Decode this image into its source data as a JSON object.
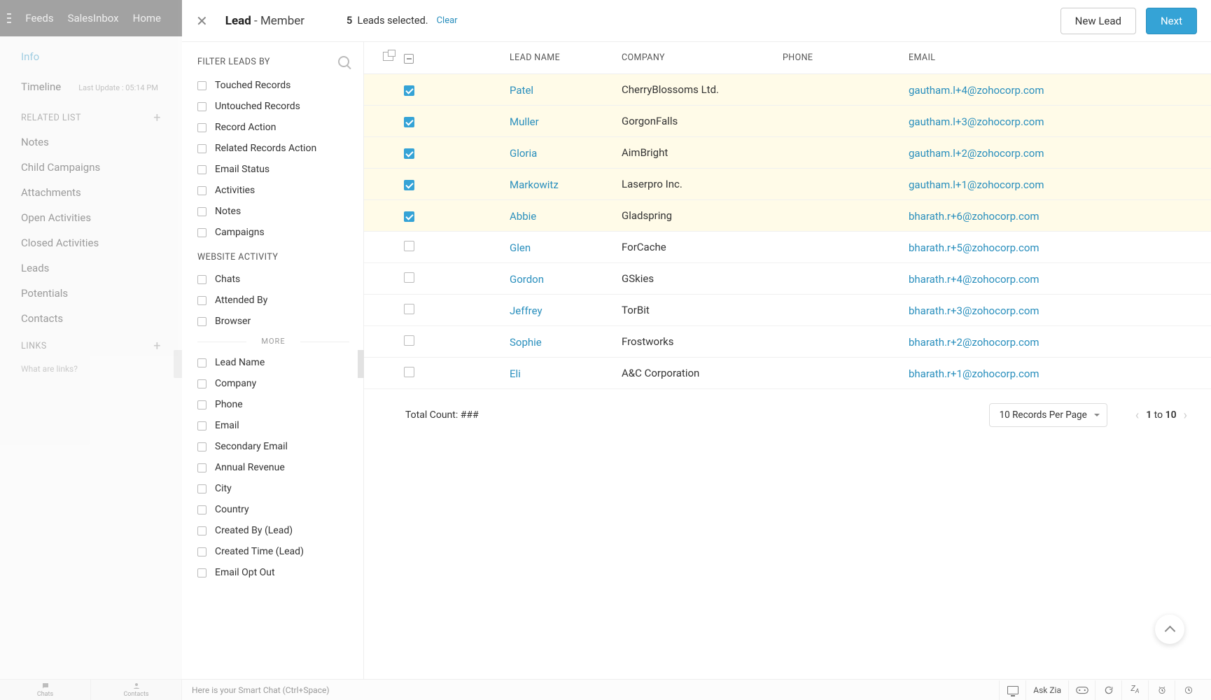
{
  "topnav": {
    "items": [
      "Feeds",
      "SalesInbox",
      "Home"
    ]
  },
  "leftrail": {
    "info": "Info",
    "timeline": "Timeline",
    "last_update": "Last Update : 05:14 PM",
    "related_list": "RELATED LIST",
    "items": [
      "Notes",
      "Child Campaigns",
      "Attachments",
      "Open Activities",
      "Closed Activities",
      "Leads",
      "Potentials",
      "Contacts"
    ],
    "links": "LINKS",
    "what_links": "What are links?"
  },
  "header": {
    "lead_label": "Lead",
    "member_label": " - Member",
    "selected_count": "5",
    "selected_text": "Leads selected.",
    "clear": "Clear",
    "new_lead": "New Lead",
    "next": "Next"
  },
  "filters": {
    "title": "FILTER LEADS BY",
    "group1": [
      "Touched Records",
      "Untouched Records",
      "Record Action",
      "Related Records Action",
      "Email Status",
      "Activities",
      "Notes",
      "Campaigns"
    ],
    "website_head": "WEBSITE ACTIVITY",
    "group2": [
      "Chats",
      "Attended By",
      "Browser"
    ],
    "more": "MORE",
    "group3": [
      "Lead Name",
      "Company",
      "Phone",
      "Email",
      "Secondary Email",
      "Annual Revenue",
      "City",
      "Country",
      "Created By (Lead)",
      "Created Time (Lead)",
      "Email Opt Out"
    ]
  },
  "table": {
    "head": {
      "name": "LEAD NAME",
      "company": "COMPANY",
      "phone": "PHONE",
      "email": "EMAIL"
    },
    "rows": [
      {
        "sel": true,
        "name": "Patel",
        "company": "CherryBlossoms Ltd.",
        "phone": "",
        "email": "gautham.l+4@zohocorp.com"
      },
      {
        "sel": true,
        "name": "Muller",
        "company": "GorgonFalls",
        "phone": "",
        "email": "gautham.l+3@zohocorp.com"
      },
      {
        "sel": true,
        "name": "Gloria",
        "company": "AimBright",
        "phone": "",
        "email": "gautham.l+2@zohocorp.com"
      },
      {
        "sel": true,
        "name": "Markowitz",
        "company": "Laserpro Inc.",
        "phone": "",
        "email": "gautham.l+1@zohocorp.com"
      },
      {
        "sel": true,
        "name": "Abbie",
        "company": "Gladspring",
        "phone": "",
        "email": "bharath.r+6@zohocorp.com"
      },
      {
        "sel": false,
        "name": "Glen",
        "company": "ForCache",
        "phone": "",
        "email": "bharath.r+5@zohocorp.com"
      },
      {
        "sel": false,
        "name": "Gordon",
        "company": "GSkies",
        "phone": "",
        "email": "bharath.r+4@zohocorp.com"
      },
      {
        "sel": false,
        "name": "Jeffrey",
        "company": "TorBit",
        "phone": "",
        "email": "bharath.r+3@zohocorp.com"
      },
      {
        "sel": false,
        "name": "Sophie",
        "company": "Frostworks",
        "phone": "",
        "email": "bharath.r+2@zohocorp.com"
      },
      {
        "sel": false,
        "name": "Eli",
        "company": "A&C Corporation",
        "phone": "",
        "email": "bharath.r+1@zohocorp.com"
      }
    ],
    "total_count": "Total Count: ###",
    "per_page": "10 Records Per Page",
    "page_from": "1",
    "page_to_word": "to",
    "page_to": "10"
  },
  "bottom": {
    "chats": "Chats",
    "contacts": "Contacts",
    "smart_chat": "Here is your Smart Chat (Ctrl+Space)",
    "ask_zia": "Ask Zia"
  }
}
